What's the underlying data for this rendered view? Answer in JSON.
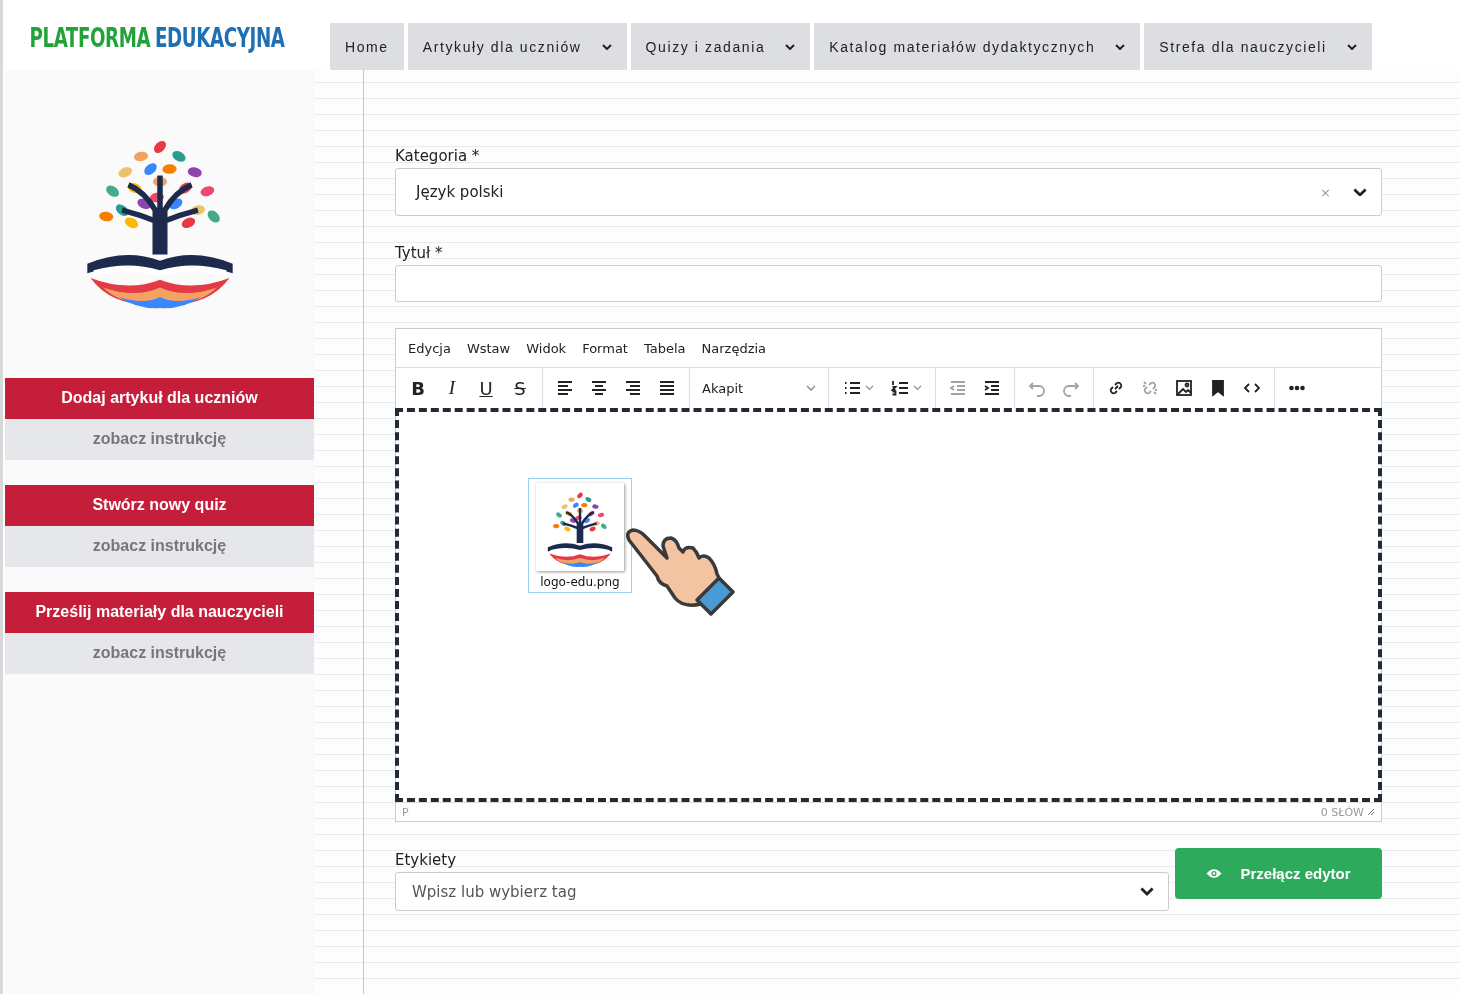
{
  "logo": {
    "word_1": "PLATFORMA",
    "word_2": "EDUKACYJNA"
  },
  "nav": [
    {
      "label": "Home",
      "dropdown": false
    },
    {
      "label": "Artykuły dla uczniów",
      "dropdown": true
    },
    {
      "label": "Quizy i zadania",
      "dropdown": true
    },
    {
      "label": "Katalog materiałów dydaktycznych",
      "dropdown": true
    },
    {
      "label": "Strefa dla nauczycieli",
      "dropdown": true
    }
  ],
  "sidebar": {
    "actions": [
      {
        "label": "Dodaj artykuł dla uczniów",
        "help": "zobacz instrukcję"
      },
      {
        "label": "Stwórz nowy quiz",
        "help": "zobacz instrukcję"
      },
      {
        "label": "Prześlij materiały dla nauczycieli",
        "help": "zobacz instrukcję"
      }
    ]
  },
  "form": {
    "category": {
      "label": "Kategoria *",
      "value": "Język polski",
      "clear": "×"
    },
    "title": {
      "label": "Tytuł *"
    },
    "editor": {
      "menu": [
        "Edycja",
        "Wstaw",
        "Widok",
        "Format",
        "Tabela",
        "Narzędzia"
      ],
      "toolbar": [
        [
          {
            "kind": "bold",
            "label": "B",
            "disabled": false
          },
          {
            "kind": "italic",
            "label": "I",
            "disabled": false
          },
          {
            "kind": "underline",
            "label": "U",
            "disabled": false
          },
          {
            "kind": "strike",
            "label": "S",
            "disabled": false
          }
        ],
        [
          {
            "kind": "align-left",
            "disabled": false
          },
          {
            "kind": "align-center",
            "disabled": false
          },
          {
            "kind": "align-right",
            "disabled": false
          },
          {
            "kind": "justify",
            "disabled": false
          }
        ],
        [
          {
            "kind": "select",
            "label": "Akapit",
            "disabled": false
          }
        ],
        [
          {
            "kind": "bullet-list",
            "disabled": false
          },
          {
            "kind": "number-list",
            "disabled": false
          }
        ],
        [
          {
            "kind": "outdent",
            "disabled": true
          },
          {
            "kind": "indent",
            "disabled": false
          }
        ],
        [
          {
            "kind": "undo",
            "disabled": true
          },
          {
            "kind": "redo",
            "disabled": true
          }
        ],
        [
          {
            "kind": "link",
            "disabled": false
          },
          {
            "kind": "unlink",
            "disabled": true
          },
          {
            "kind": "image",
            "disabled": false
          },
          {
            "kind": "bookmark",
            "disabled": false
          },
          {
            "kind": "code",
            "disabled": false
          }
        ],
        [
          {
            "kind": "more",
            "disabled": false
          }
        ]
      ],
      "dragged_file": "logo-edu.png",
      "path": "P",
      "word_count": "0 SŁÓW"
    },
    "tags": {
      "label": "Etykiety",
      "placeholder": "Wpisz lub wybierz tag"
    },
    "toggle_button": "Przełącz edytor"
  }
}
